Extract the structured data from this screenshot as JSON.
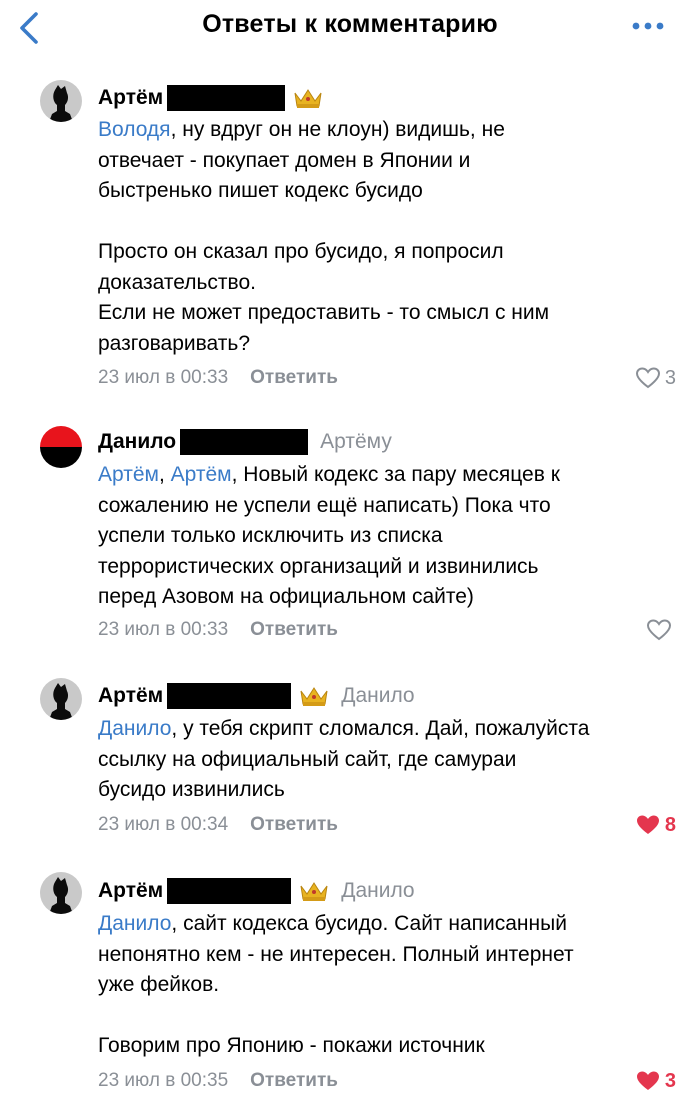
{
  "header": {
    "title": "Ответы к комментарию",
    "accent": "#3a7bc8"
  },
  "comments": [
    {
      "author": "Артём",
      "reply_to": "",
      "mentions": [
        "Володя"
      ],
      "text_after": ", ну вдруг он не клоун) видишь, не\nотвечает - покупает домен в Японии и\nбыстренько пишет кодекс бусидо\n\nПросто он сказал про бусидо, я попросил\nдоказательство.\nЕсли не может предоставить - то смысл с ним\nразговаривать?",
      "date": "23 июл в 00:33",
      "reply_label": "Ответить",
      "likes": "3",
      "liked": false
    },
    {
      "author": "Данило",
      "reply_to": "Артёму",
      "mentions": [
        "Артём",
        "Артём"
      ],
      "text_after": ", Новый кодекс за пару месяцев к\nсожалению не успели ещё написать) Пока что\nуспели только исключить из списка\nтеррористических организаций и извинились\nперед Азовом на официальном сайте)",
      "date": "23 июл в 00:33",
      "reply_label": "Ответить",
      "likes": "",
      "liked": false
    },
    {
      "author": "Артём",
      "reply_to": "Данило",
      "mentions": [
        "Данило"
      ],
      "text_after": ", у тебя скрипт сломался. Дай, пожалуйста\nссылку на официальный сайт, где самураи\nбусидо извинились",
      "date": "23 июл в 00:34",
      "reply_label": "Ответить",
      "likes": "8",
      "liked": true
    },
    {
      "author": "Артём",
      "reply_to": "Данило",
      "mentions": [
        "Данило"
      ],
      "text_after": ", сайт кодекса бусидо. Сайт написанный\nнепонятно кем - не интересен. Полный интернет\nуже фейков.\n\nГоворим про Японию - покажи источник",
      "date": "23 июл в 00:35",
      "reply_label": "Ответить",
      "likes": "3",
      "liked": true
    }
  ],
  "colors": {
    "mention": "#3a7bc8",
    "meta": "#8a8f96",
    "like_active": "#e4364e",
    "avatar_flag_top": "#e8141c",
    "avatar_flag_bottom": "#000000"
  },
  "icons": {
    "back": "chevron-left-icon",
    "more": "ellipsis-icon",
    "crown": "crown-icon",
    "heart": "heart-icon"
  }
}
